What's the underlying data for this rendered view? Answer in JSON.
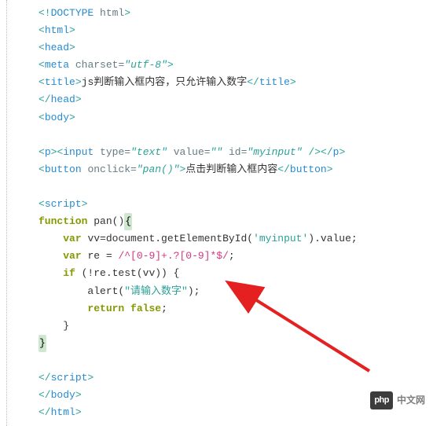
{
  "code": {
    "doctype": "<!DOCTYPE html>",
    "html_open": "<html>",
    "head_open": "<head>",
    "meta_line": {
      "tag": "meta",
      "attr": "charset",
      "val": "\"utf-8\""
    },
    "title_line": {
      "open": "<title>",
      "text": "js判断输入框内容，只允许输入数字",
      "close": "</title>"
    },
    "head_close": "</head>",
    "body_open": "<body>",
    "input_line": {
      "p_open": "<p>",
      "inp_open": "<input",
      "attrs": [
        {
          "name": "type",
          "val": "\"text\""
        },
        {
          "name": "value",
          "val": "\"\""
        },
        {
          "name": "id",
          "val": "\"myinput\""
        }
      ],
      "inp_close": " />",
      "p_close": "</p>"
    },
    "button_line": {
      "open": "<button",
      "attr": "onclick",
      "val": "\"pan()\"",
      "end_open": ">",
      "text": "点击判断输入框内容",
      "close": "</button>"
    },
    "script_open": "<script>",
    "fn_kw": "function",
    "fn_name": "pan",
    "var_kw": "var",
    "vv_decl": "vv=document.getElementById(",
    "vv_arg": "'myinput'",
    "vv_tail": ").value;",
    "re_decl": "re = ",
    "re_val": "/^[0-9]+.?[0-9]*$/",
    "re_semi": ";",
    "if_kw": "if",
    "if_cond": " (!re.test(vv)) {",
    "alert_call": "alert(",
    "alert_arg": "\"请输入数字\"",
    "alert_tail": ");",
    "return_kw": "return",
    "false_kw": "false",
    "ret_semi": ";",
    "brace_close1": "}",
    "brace_close2": "}",
    "script_close_a": "</",
    "script_close_b": "script",
    "script_close_c": ">",
    "body_close": "</body>",
    "html_close": "</html>"
  },
  "watermark": {
    "logo": "php",
    "text": "中文网"
  }
}
